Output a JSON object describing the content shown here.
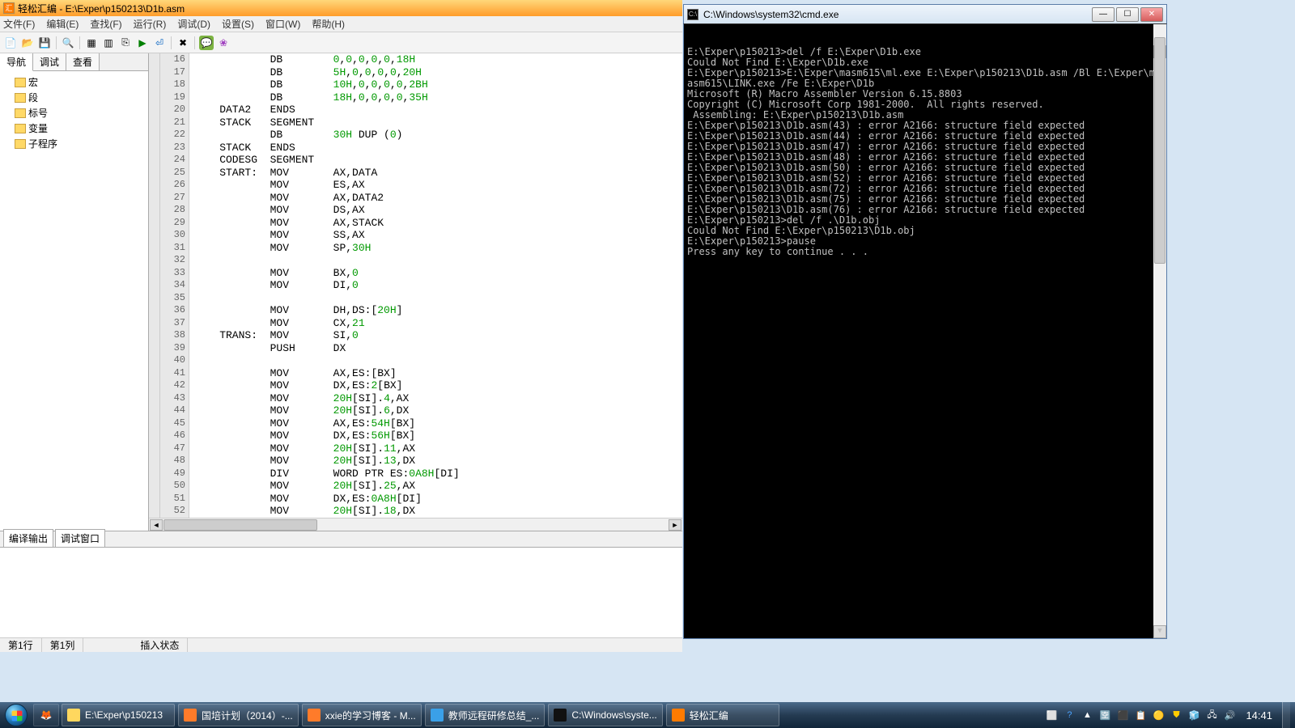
{
  "editor": {
    "title": "轻松汇编 - E:\\Exper\\p150213\\D1b.asm",
    "menus": [
      "文件(F)",
      "编辑(E)",
      "查找(F)",
      "运行(R)",
      "调试(D)",
      "设置(S)",
      "窗口(W)",
      "帮助(H)"
    ],
    "side_tabs": [
      "导航",
      "调试",
      "查看"
    ],
    "tree": [
      "宏",
      "段",
      "标号",
      "变量",
      "子程序"
    ],
    "gutter_start": 16,
    "code": [
      {
        "op": "DB",
        "args": [
          {
            "t": "0",
            "c": "num"
          },
          {
            "t": ",",
            "c": ""
          },
          {
            "t": "0",
            "c": "num"
          },
          {
            "t": ",",
            "c": ""
          },
          {
            "t": "0",
            "c": "num"
          },
          {
            "t": ",",
            "c": ""
          },
          {
            "t": "0",
            "c": "num"
          },
          {
            "t": ",",
            "c": ""
          },
          {
            "t": "0",
            "c": "num"
          },
          {
            "t": ",",
            "c": ""
          },
          {
            "t": "18H",
            "c": "num"
          }
        ]
      },
      {
        "op": "DB",
        "args": [
          {
            "t": "5H",
            "c": "num"
          },
          {
            "t": ",",
            "c": ""
          },
          {
            "t": "0",
            "c": "num"
          },
          {
            "t": ",",
            "c": ""
          },
          {
            "t": "0",
            "c": "num"
          },
          {
            "t": ",",
            "c": ""
          },
          {
            "t": "0",
            "c": "num"
          },
          {
            "t": ",",
            "c": ""
          },
          {
            "t": "0",
            "c": "num"
          },
          {
            "t": ",",
            "c": ""
          },
          {
            "t": "20H",
            "c": "num"
          }
        ]
      },
      {
        "op": "DB",
        "args": [
          {
            "t": "10H",
            "c": "num"
          },
          {
            "t": ",",
            "c": ""
          },
          {
            "t": "0",
            "c": "num"
          },
          {
            "t": ",",
            "c": ""
          },
          {
            "t": "0",
            "c": "num"
          },
          {
            "t": ",",
            "c": ""
          },
          {
            "t": "0",
            "c": "num"
          },
          {
            "t": ",",
            "c": ""
          },
          {
            "t": "0",
            "c": "num"
          },
          {
            "t": ",",
            "c": ""
          },
          {
            "t": "2BH",
            "c": "num"
          }
        ]
      },
      {
        "op": "DB",
        "args": [
          {
            "t": "18H",
            "c": "num"
          },
          {
            "t": ",",
            "c": ""
          },
          {
            "t": "0",
            "c": "num"
          },
          {
            "t": ",",
            "c": ""
          },
          {
            "t": "0",
            "c": "num"
          },
          {
            "t": ",",
            "c": ""
          },
          {
            "t": "0",
            "c": "num"
          },
          {
            "t": ",",
            "c": ""
          },
          {
            "t": "0",
            "c": "num"
          },
          {
            "t": ",",
            "c": ""
          },
          {
            "t": "35H",
            "c": "num"
          }
        ]
      },
      {
        "lbl": "DATA2",
        "op": "ENDS",
        "args": []
      },
      {
        "lbl": "STACK",
        "op": "SEGMENT",
        "args": []
      },
      {
        "op": "DB",
        "args": [
          {
            "t": "30H",
            "c": "num"
          },
          {
            "t": " DUP (",
            "c": ""
          },
          {
            "t": "0",
            "c": "num"
          },
          {
            "t": ")",
            "c": ""
          }
        ]
      },
      {
        "lbl": "STACK",
        "op": "ENDS",
        "args": []
      },
      {
        "lbl": "CODESG",
        "op": "SEGMENT",
        "args": []
      },
      {
        "lbl": "START:",
        "op": "MOV",
        "args": [
          {
            "t": "AX,DATA",
            "c": ""
          }
        ]
      },
      {
        "op": "MOV",
        "args": [
          {
            "t": "ES,AX",
            "c": ""
          }
        ]
      },
      {
        "op": "MOV",
        "args": [
          {
            "t": "AX,DATA2",
            "c": ""
          }
        ]
      },
      {
        "op": "MOV",
        "args": [
          {
            "t": "DS,AX",
            "c": ""
          }
        ]
      },
      {
        "op": "MOV",
        "args": [
          {
            "t": "AX,STACK",
            "c": ""
          }
        ]
      },
      {
        "op": "MOV",
        "args": [
          {
            "t": "SS,AX",
            "c": ""
          }
        ]
      },
      {
        "op": "MOV",
        "args": [
          {
            "t": "SP,",
            "c": ""
          },
          {
            "t": "30H",
            "c": "num"
          }
        ]
      },
      {
        "op": "",
        "args": []
      },
      {
        "op": "MOV",
        "args": [
          {
            "t": "BX,",
            "c": ""
          },
          {
            "t": "0",
            "c": "num"
          }
        ]
      },
      {
        "op": "MOV",
        "args": [
          {
            "t": "DI,",
            "c": ""
          },
          {
            "t": "0",
            "c": "num"
          }
        ]
      },
      {
        "op": "",
        "args": []
      },
      {
        "op": "MOV",
        "args": [
          {
            "t": "DH,DS:[",
            "c": ""
          },
          {
            "t": "20H",
            "c": "num"
          },
          {
            "t": "]",
            "c": ""
          }
        ]
      },
      {
        "op": "MOV",
        "args": [
          {
            "t": "CX,",
            "c": ""
          },
          {
            "t": "21",
            "c": "num"
          }
        ]
      },
      {
        "lbl": "TRANS:",
        "op": "MOV",
        "args": [
          {
            "t": "SI,",
            "c": ""
          },
          {
            "t": "0",
            "c": "num"
          }
        ]
      },
      {
        "op": "PUSH",
        "args": [
          {
            "t": "DX",
            "c": ""
          }
        ]
      },
      {
        "op": "",
        "args": []
      },
      {
        "op": "MOV",
        "args": [
          {
            "t": "AX,ES:[BX]",
            "c": ""
          }
        ]
      },
      {
        "op": "MOV",
        "args": [
          {
            "t": "DX,ES:",
            "c": ""
          },
          {
            "t": "2",
            "c": "num"
          },
          {
            "t": "[BX]",
            "c": ""
          }
        ]
      },
      {
        "op": "MOV",
        "args": [
          {
            "t": "20H",
            "c": "num"
          },
          {
            "t": "[SI].",
            "c": ""
          },
          {
            "t": "4",
            "c": "num"
          },
          {
            "t": ",AX",
            "c": ""
          }
        ]
      },
      {
        "op": "MOV",
        "args": [
          {
            "t": "20H",
            "c": "num"
          },
          {
            "t": "[SI].",
            "c": ""
          },
          {
            "t": "6",
            "c": "num"
          },
          {
            "t": ",DX",
            "c": ""
          }
        ]
      },
      {
        "op": "MOV",
        "args": [
          {
            "t": "AX,ES:",
            "c": ""
          },
          {
            "t": "54H",
            "c": "num"
          },
          {
            "t": "[BX]",
            "c": ""
          }
        ]
      },
      {
        "op": "MOV",
        "args": [
          {
            "t": "DX,ES:",
            "c": ""
          },
          {
            "t": "56H",
            "c": "num"
          },
          {
            "t": "[BX]",
            "c": ""
          }
        ]
      },
      {
        "op": "MOV",
        "args": [
          {
            "t": "20H",
            "c": "num"
          },
          {
            "t": "[SI].",
            "c": ""
          },
          {
            "t": "11",
            "c": "num"
          },
          {
            "t": ",AX",
            "c": ""
          }
        ]
      },
      {
        "op": "MOV",
        "args": [
          {
            "t": "20H",
            "c": "num"
          },
          {
            "t": "[SI].",
            "c": ""
          },
          {
            "t": "13",
            "c": "num"
          },
          {
            "t": ",DX",
            "c": ""
          }
        ]
      },
      {
        "op": "DIV",
        "args": [
          {
            "t": "WORD PTR ES:",
            "c": ""
          },
          {
            "t": "0A8H",
            "c": "num"
          },
          {
            "t": "[DI]",
            "c": ""
          }
        ]
      },
      {
        "op": "MOV",
        "args": [
          {
            "t": "20H",
            "c": "num"
          },
          {
            "t": "[SI].",
            "c": ""
          },
          {
            "t": "25",
            "c": "num"
          },
          {
            "t": ",AX",
            "c": ""
          }
        ]
      },
      {
        "op": "MOV",
        "args": [
          {
            "t": "DX,ES:",
            "c": ""
          },
          {
            "t": "0A8H",
            "c": "num"
          },
          {
            "t": "[DI]",
            "c": ""
          }
        ]
      },
      {
        "op": "MOV",
        "args": [
          {
            "t": "20H",
            "c": "num"
          },
          {
            "t": "[SI].",
            "c": ""
          },
          {
            "t": "18",
            "c": "num"
          },
          {
            "t": ",DX",
            "c": ""
          }
        ]
      }
    ],
    "bottom_tabs": [
      "编译输出",
      "调试窗口"
    ],
    "status": [
      "第1行",
      "第1列",
      "插入状态"
    ]
  },
  "cmd": {
    "title": "C:\\Windows\\system32\\cmd.exe",
    "lines": [
      "",
      "E:\\Exper\\p150213>del /f E:\\Exper\\D1b.exe",
      "Could Not Find E:\\Exper\\D1b.exe",
      "",
      "E:\\Exper\\p150213>E:\\Exper\\masm615\\ml.exe E:\\Exper\\p150213\\D1b.asm /Bl E:\\Exper\\m",
      "asm615\\LINK.exe /Fe E:\\Exper\\D1b",
      "Microsoft (R) Macro Assembler Version 6.15.8803",
      "Copyright (C) Microsoft Corp 1981-2000.  All rights reserved.",
      "",
      " Assembling: E:\\Exper\\p150213\\D1b.asm",
      "E:\\Exper\\p150213\\D1b.asm(43) : error A2166: structure field expected",
      "E:\\Exper\\p150213\\D1b.asm(44) : error A2166: structure field expected",
      "E:\\Exper\\p150213\\D1b.asm(47) : error A2166: structure field expected",
      "E:\\Exper\\p150213\\D1b.asm(48) : error A2166: structure field expected",
      "E:\\Exper\\p150213\\D1b.asm(50) : error A2166: structure field expected",
      "E:\\Exper\\p150213\\D1b.asm(52) : error A2166: structure field expected",
      "E:\\Exper\\p150213\\D1b.asm(72) : error A2166: structure field expected",
      "E:\\Exper\\p150213\\D1b.asm(75) : error A2166: structure field expected",
      "E:\\Exper\\p150213\\D1b.asm(76) : error A2166: structure field expected",
      "",
      "E:\\Exper\\p150213>del /f .\\D1b.obj",
      "Could Not Find E:\\Exper\\p150213\\D1b.obj",
      "",
      "E:\\Exper\\p150213>pause",
      "Press any key to continue . . ."
    ]
  },
  "taskbar": {
    "tasks": [
      {
        "label": "E:\\Exper\\p150213",
        "color": "#ffd75e"
      },
      {
        "label": "国培计划（2014）-...",
        "color": "#ff7b2a"
      },
      {
        "label": "xxie的学习博客 - M...",
        "color": "#ff7b2a"
      },
      {
        "label": "教师远程研修总结_...",
        "color": "#3aa0e8"
      },
      {
        "label": "C:\\Windows\\syste...",
        "color": "#111"
      },
      {
        "label": "轻松汇编",
        "color": "#ff7b00"
      }
    ],
    "clock": "14:41"
  }
}
